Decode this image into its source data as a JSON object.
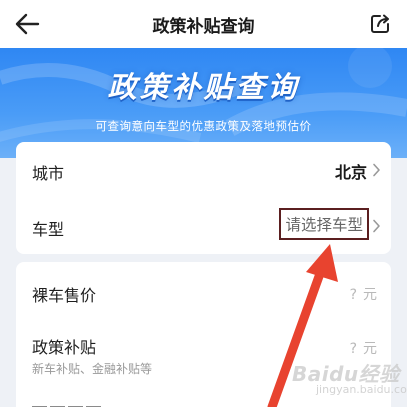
{
  "header": {
    "title": "政策补贴查询"
  },
  "hero": {
    "title": "政策补贴查询",
    "subtitle": "可查询意向车型的优惠政策及落地预估价"
  },
  "selection": {
    "city_label": "城市",
    "city_value": "北京",
    "model_label": "车型",
    "model_placeholder": "请选择车型"
  },
  "results": {
    "price_label": "裸车售价",
    "price_value": "?",
    "price_unit": "元",
    "subsidy_label": "政策补贴",
    "subsidy_hint": "新车补贴、金融补贴等",
    "subsidy_value": "?",
    "subsidy_unit": "元"
  },
  "watermark": {
    "text": "Baidu经验",
    "sub": "jingyan.baidu.com"
  },
  "colors": {
    "hero_blue": "#2f87f3",
    "annotation_red": "#e8432f",
    "highlight_box": "#5b1f20"
  },
  "icons": {
    "back": "back-arrow-icon",
    "share": "share-icon",
    "chevron": "chevron-right-icon"
  }
}
